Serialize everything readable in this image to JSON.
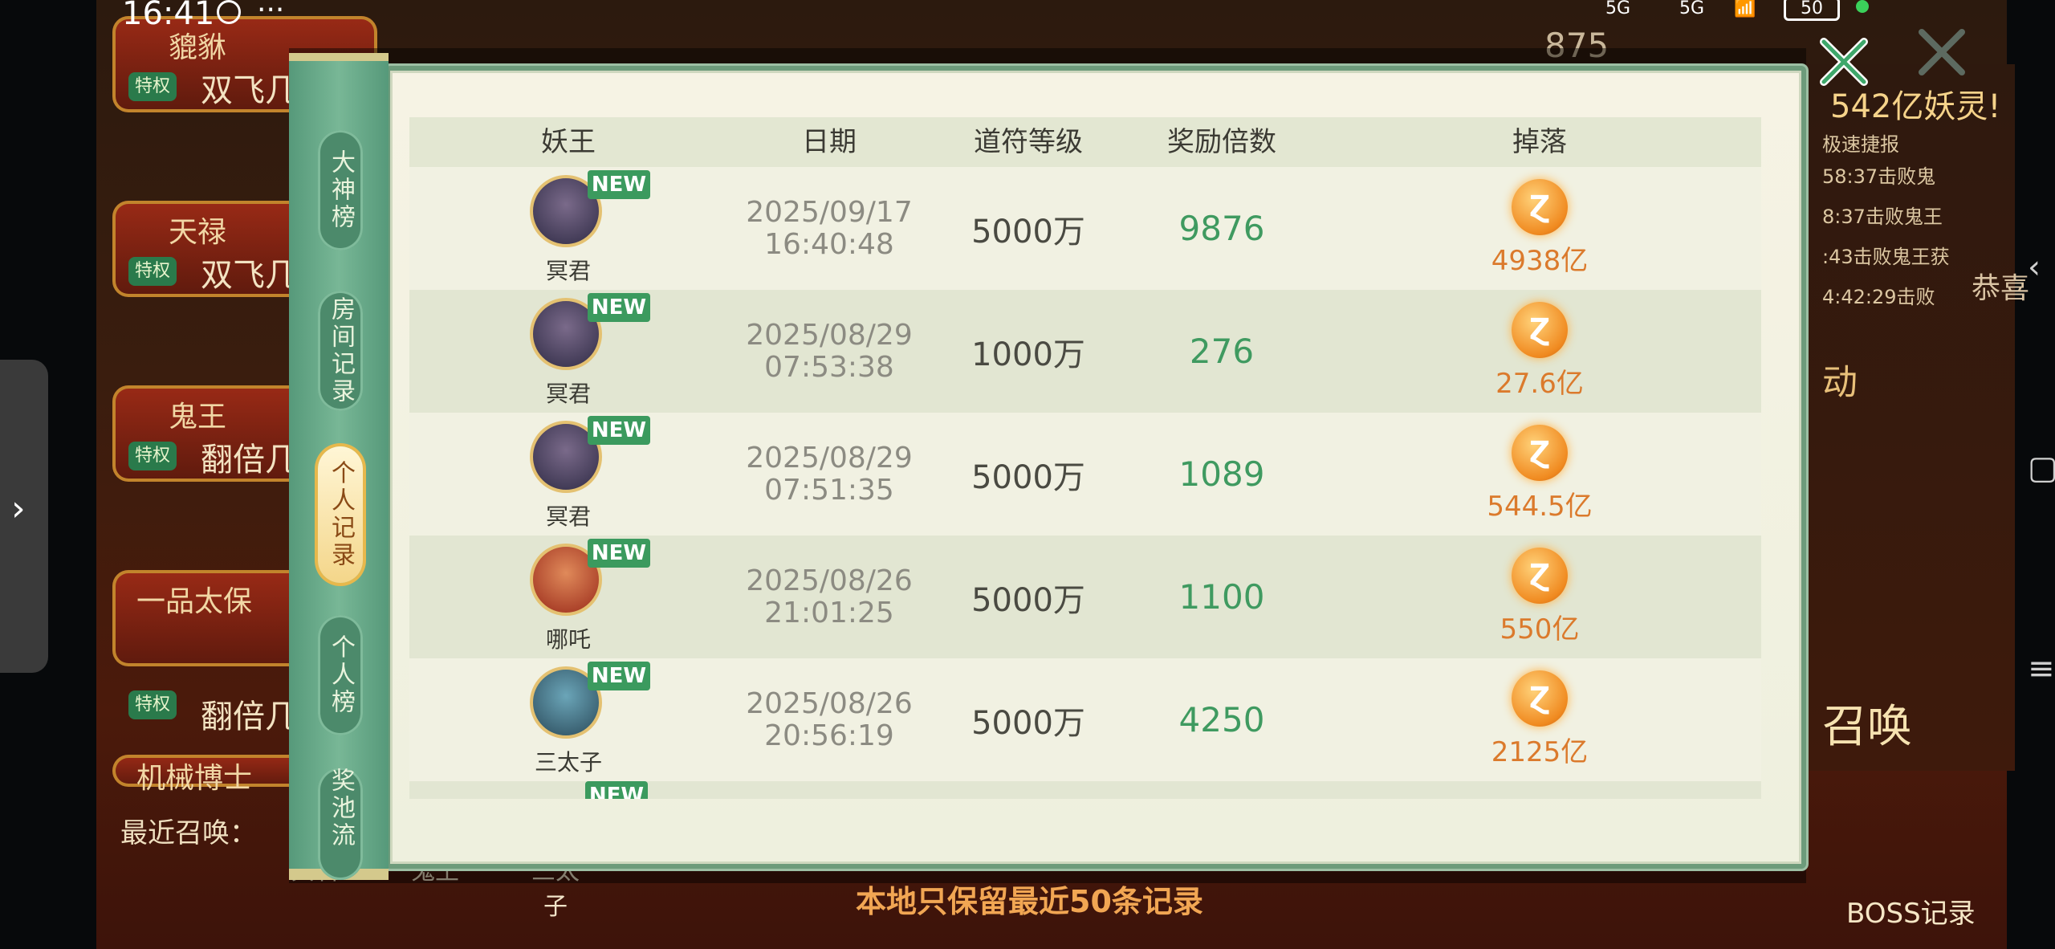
{
  "status_bar": {
    "time": "16:41",
    "dots": "···",
    "battery": "50",
    "net1": "5G",
    "net2": "5G"
  },
  "background": {
    "left_tabs": [
      {
        "name": "貔貅",
        "tag": "特权",
        "sub": "双飞几"
      },
      {
        "name": "天禄",
        "tag": "特权",
        "sub": "双飞几"
      },
      {
        "name": "鬼王",
        "tag": "特权",
        "sub": "翻倍几"
      },
      {
        "name": "一品太保",
        "tag": "特权",
        "sub": "翻倍几"
      },
      {
        "name": "机械博士"
      }
    ],
    "recent_label": "最近召唤：",
    "recent_items": [
      "冥君",
      "鬼王",
      "三太子"
    ],
    "counter": "875",
    "right_title": "542亿妖灵!",
    "right_sub": "极速捷报",
    "right_lines": [
      "58:37击败鬼",
      "8:37击败鬼王",
      ":43击败鬼王获",
      "4:42:29击败",
      "动"
    ],
    "congrats": "恭喜",
    "boss_log": "BOSS记录",
    "summon": "召唤"
  },
  "sidebar": {
    "tabs": [
      {
        "label": "大神榜",
        "active": false
      },
      {
        "label": "房间记录",
        "active": false
      },
      {
        "label": "个人记录",
        "active": true
      },
      {
        "label": "个人榜",
        "active": false
      },
      {
        "label": "奖池流",
        "active": false
      }
    ]
  },
  "table": {
    "headers": [
      "妖王",
      "日期",
      "道符等级",
      "奖励倍数",
      "掉落"
    ],
    "new_badge": "NEW",
    "coin_glyph": "Ɀ",
    "rows": [
      {
        "boss": "冥君",
        "date": "2025/09/17",
        "time": "16:40:48",
        "level": "5000万",
        "multiplier": "9876",
        "drop": "4938亿"
      },
      {
        "boss": "冥君",
        "date": "2025/08/29",
        "time": "07:53:38",
        "level": "1000万",
        "multiplier": "276",
        "drop": "27.6亿"
      },
      {
        "boss": "冥君",
        "date": "2025/08/29",
        "time": "07:51:35",
        "level": "5000万",
        "multiplier": "1089",
        "drop": "544.5亿"
      },
      {
        "boss": "哪吒",
        "date": "2025/08/26",
        "time": "21:01:25",
        "level": "5000万",
        "multiplier": "1100",
        "drop": "550亿"
      },
      {
        "boss": "三太子",
        "date": "2025/08/26",
        "time": "20:56:19",
        "level": "5000万",
        "multiplier": "4250",
        "drop": "2125亿"
      }
    ]
  },
  "footer_note": "本地只保留最近50条记录",
  "colors": {
    "accent_green": "#3f9a60",
    "drop_orange": "#db7a2c",
    "note_orange": "#f1a653"
  }
}
